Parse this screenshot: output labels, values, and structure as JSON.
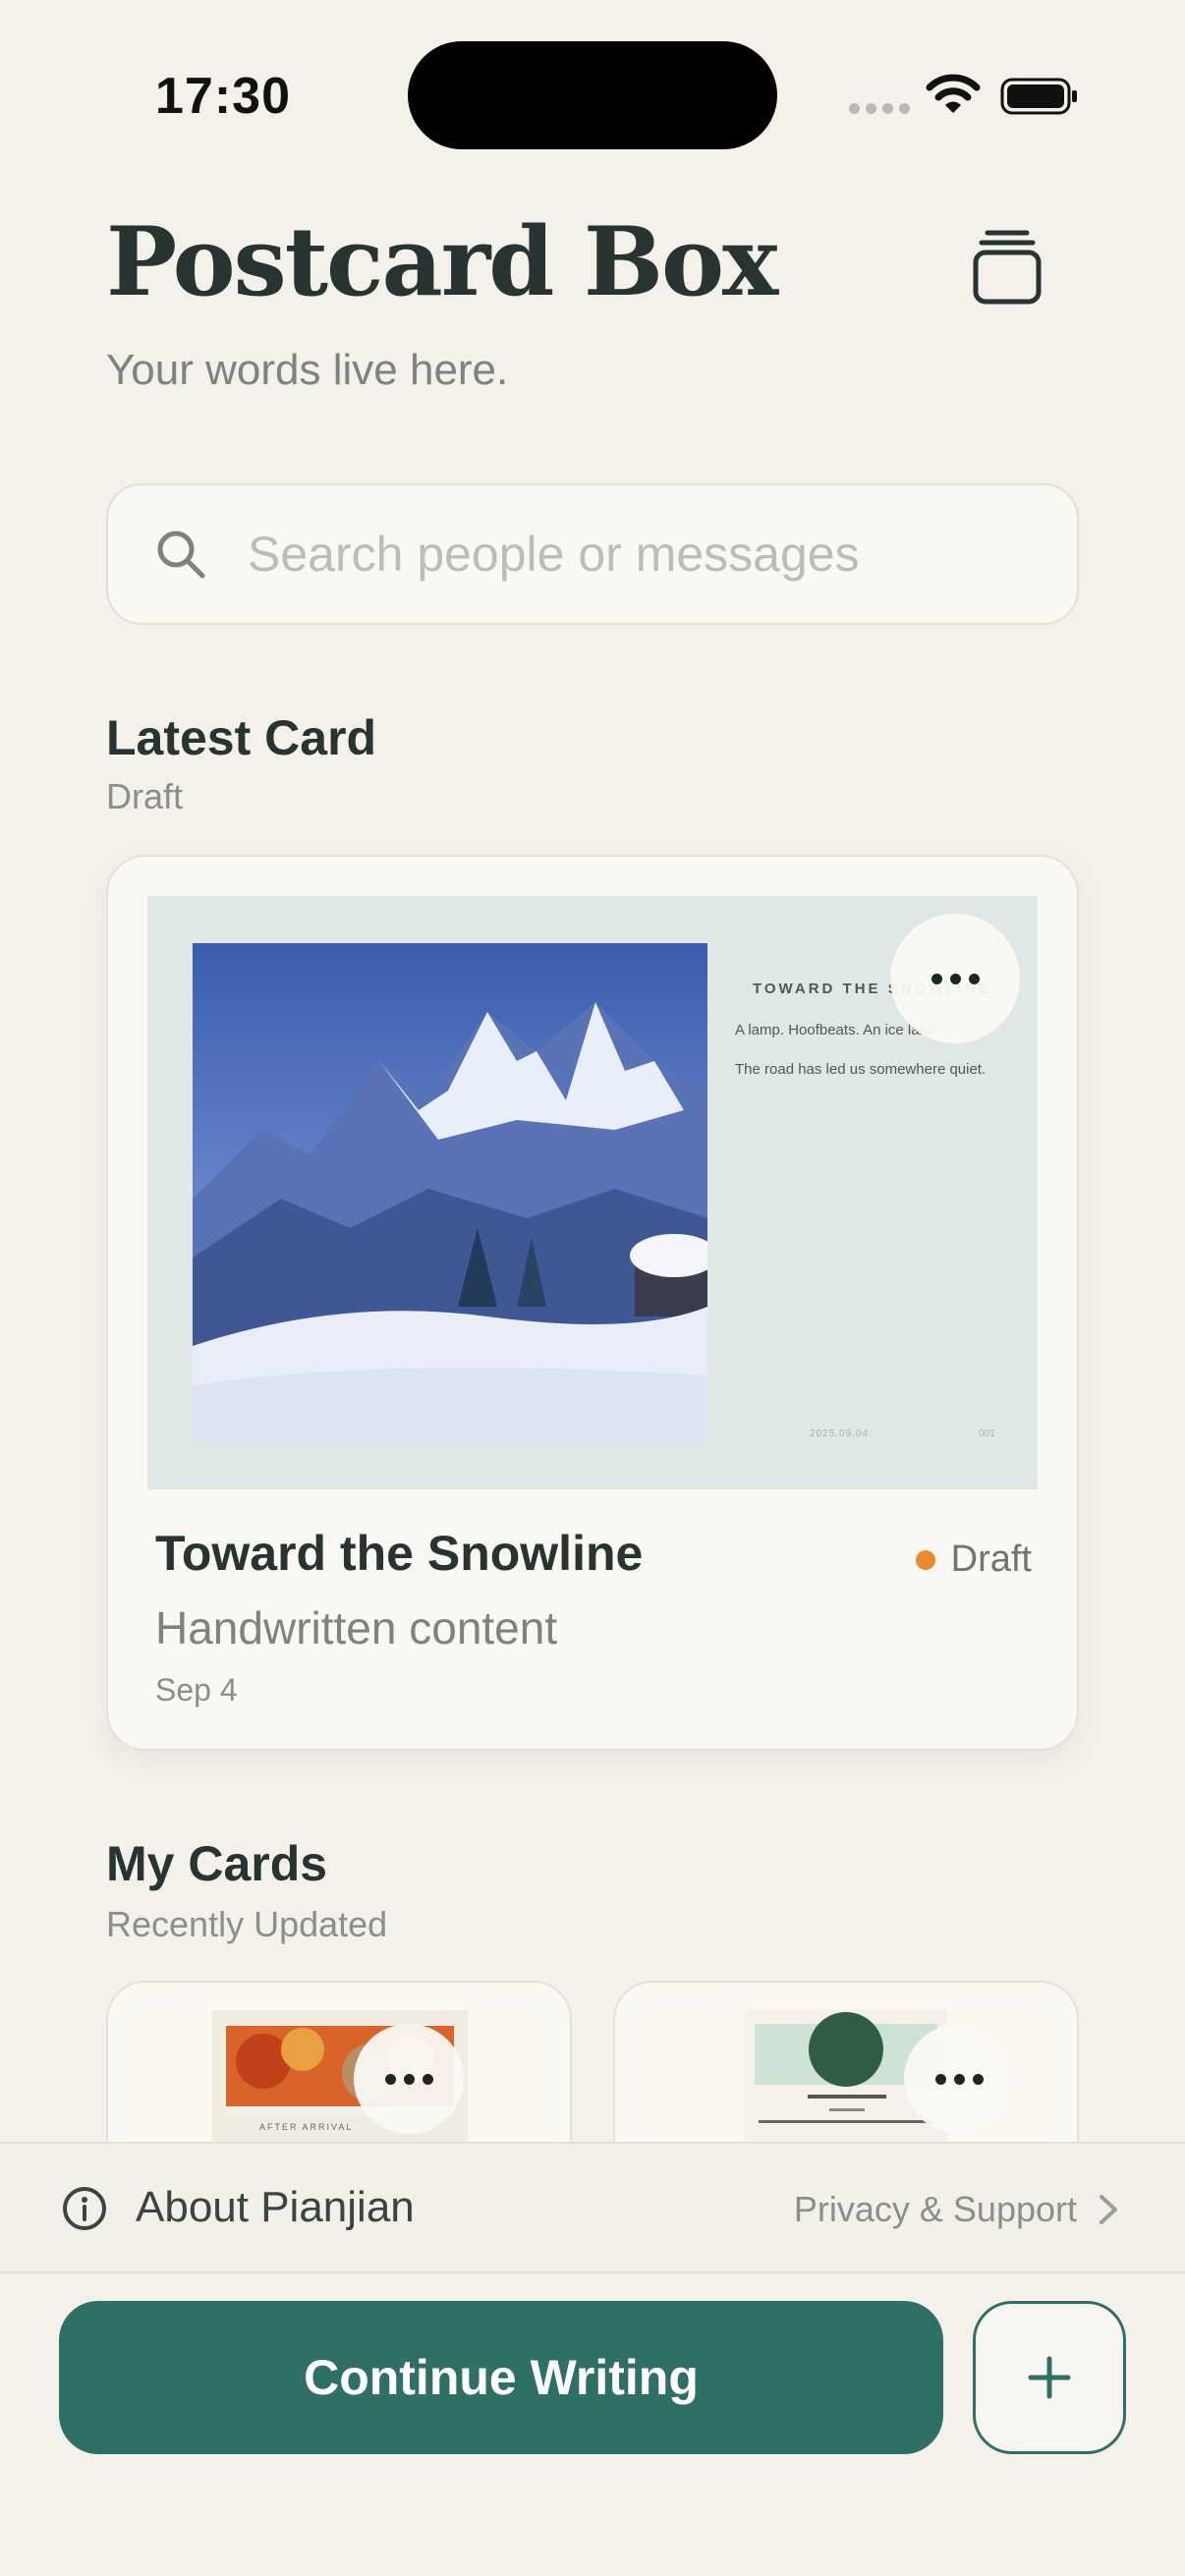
{
  "status_bar": {
    "time": "17:30"
  },
  "header": {
    "title": "Postcard Box",
    "subtitle": "Your words live here."
  },
  "search": {
    "placeholder": "Search people or messages"
  },
  "latest_section": {
    "title": "Latest Card",
    "subtitle": "Draft"
  },
  "latest_card": {
    "title": "Toward the Snowline",
    "status": "Draft",
    "status_color": "#ee8a2e",
    "description": "Handwritten content",
    "date": "Sep 4",
    "postcard": {
      "heading": "TOWARD THE SNOWLINE",
      "line1": "A lamp. Hoofbeats. An ice lake.",
      "line2": "The road has led us somewhere quiet.",
      "date": "2025.09.04",
      "number": "001"
    }
  },
  "my_cards_section": {
    "title": "My Cards",
    "subtitle": "Recently Updated"
  },
  "my_cards": [
    {
      "preview_caption": "AFTER ARRIVAL",
      "icon": "more-icon"
    },
    {
      "preview_caption": "",
      "icon": "more-icon"
    }
  ],
  "about_bar": {
    "label": "About Pianjian",
    "link": "Privacy & Support"
  },
  "actions": {
    "continue_label": "Continue Writing",
    "add_icon": "plus-icon"
  },
  "colors": {
    "accent": "#2f7066",
    "background": "#f3f1ea",
    "title": "#283431"
  }
}
